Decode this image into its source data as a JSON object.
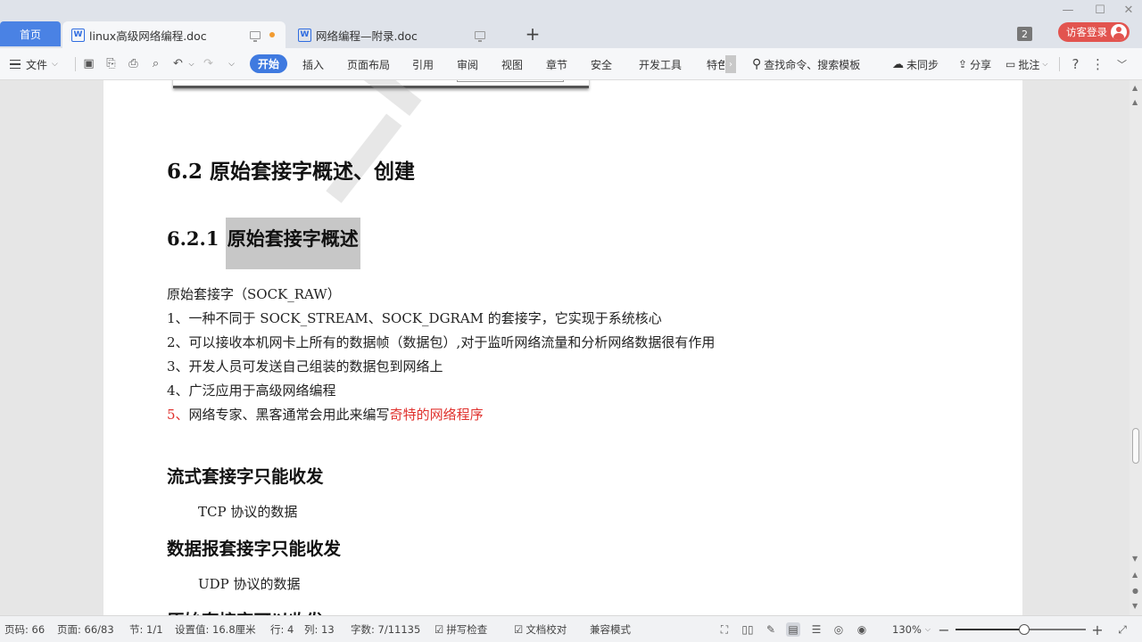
{
  "tabs": {
    "home": "首页",
    "docs": [
      {
        "title": "linux高级网络编程.doc",
        "active": true,
        "unsaved": true
      },
      {
        "title": "网络编程—附录.doc",
        "active": false,
        "unsaved": false
      }
    ],
    "tab_count": "2",
    "login": "访客登录"
  },
  "ribbon": {
    "file": "文件",
    "tabs": [
      "开始",
      "插入",
      "页面布局",
      "引用",
      "审阅",
      "视图",
      "章节",
      "安全",
      "开发工具",
      "特色"
    ],
    "active_tab": "开始",
    "search": "查找命令、搜索模板",
    "sync": "未同步",
    "share": "分享",
    "comment": "批注"
  },
  "document": {
    "h2": "6.2 原始套接字概述、创建",
    "h3_num": "6.2.1",
    "h3_text": "原始套接字概述",
    "intro": "原始套接字（SOCK_RAW）",
    "items": [
      "1、一种不同于 SOCK_STREAM、SOCK_DGRAM 的套接字，它实现于系统核心",
      "2、可以接收本机网卡上所有的数据帧（数据包）,对于监听网络流量和分析网络数据很有作用",
      "3、开发人员可发送自己组装的数据包到网络上",
      "4、广泛应用于高级网络编程"
    ],
    "item5_num": "5、",
    "item5_text": "网络专家、黑客通常会用此来编写",
    "item5_red": "奇特的网络程序",
    "sec_stream": "流式套接字只能收发",
    "sec_stream_sub": "TCP 协议的数据",
    "sec_dgram": "数据报套接字只能收发",
    "sec_dgram_sub": "UDP 协议的数据",
    "sec_raw": "原始套接字可以收发"
  },
  "status": {
    "page_no": "页码: 66",
    "pages": "页面: 66/83",
    "section": "节: 1/1",
    "setting": "设置值: 16.8厘米",
    "row": "行: 4",
    "col": "列: 13",
    "chars": "字数: 7/11135",
    "spell": "拼写检查",
    "proof": "文档校对",
    "compat": "兼容模式",
    "zoom": "130%",
    "zoom_level": 0.53
  },
  "colors": {
    "accent": "#3f7ae0",
    "home_tab": "#4a82e4",
    "login": "#e2544f",
    "red_text": "#e0312d"
  }
}
